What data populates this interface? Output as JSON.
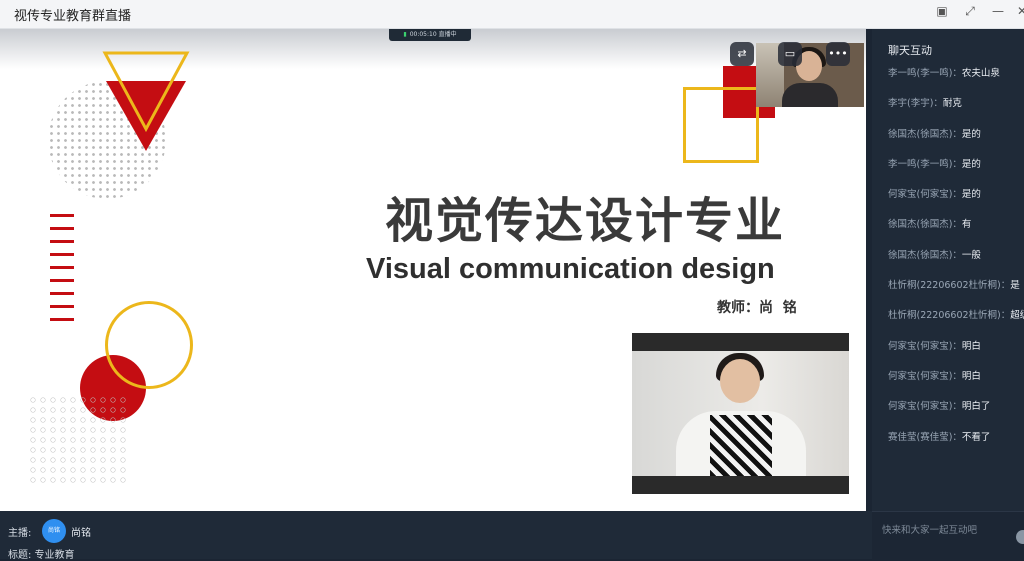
{
  "window": {
    "title": "视传专业教育群直播",
    "controls": [
      "▣",
      "⤢",
      "—"
    ]
  },
  "live_status": {
    "duration": "00:05:10",
    "state": "直播中"
  },
  "slide": {
    "title_cn": "视觉传达设计专业",
    "title_en": "Visual communication design",
    "teacher": "教师：尚  铭",
    "colors": {
      "accent_red": "#c40d12",
      "accent_yellow": "#ecb71b"
    }
  },
  "camera_controls": {
    "switch_icon": "camera-switch-icon",
    "screen_icon": "screen-share-icon",
    "more_label": "•••"
  },
  "chat": {
    "title": "聊天互动",
    "input_placeholder": "快来和大家一起互动吧",
    "messages": [
      {
        "sender": "李一鸣(李一鸣)：",
        "text": "农夫山泉"
      },
      {
        "sender": "李宇(李宇)：",
        "text": "耐克"
      },
      {
        "sender": "徐国杰(徐国杰)：",
        "text": "是的"
      },
      {
        "sender": "李一鸣(李一鸣)：",
        "text": "是的"
      },
      {
        "sender": "何家宝(何家宝)：",
        "text": "是的"
      },
      {
        "sender": "徐国杰(徐国杰)：",
        "text": "有"
      },
      {
        "sender": "徐国杰(徐国杰)：",
        "text": "一般"
      },
      {
        "sender": "杜忻桐(22206602杜忻桐)：",
        "text": "是"
      },
      {
        "sender": "杜忻桐(22206602杜忻桐)：",
        "text": "超级"
      },
      {
        "sender": "何家宝(何家宝)：",
        "text": "明白"
      },
      {
        "sender": "何家宝(何家宝)：",
        "text": "明白"
      },
      {
        "sender": "何家宝(何家宝)：",
        "text": "明白了"
      },
      {
        "sender": "赛佳莹(赛佳莹)：",
        "text": "不看了"
      }
    ]
  },
  "host": {
    "label": "主播:",
    "avatar_text": "尚铭",
    "name": "尚铭",
    "subject": "标题: 专业教育"
  }
}
